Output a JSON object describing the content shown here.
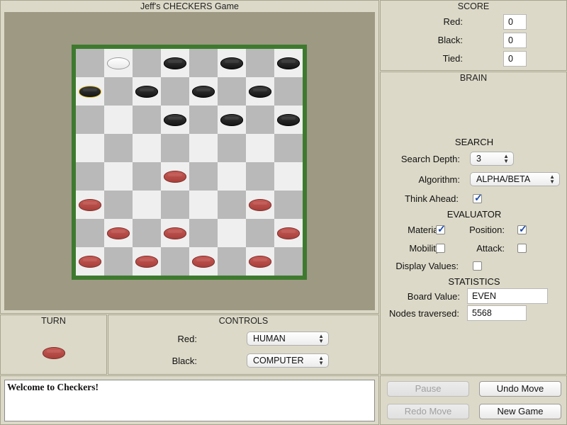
{
  "game": {
    "title": "Jeff's CHECKERS Game"
  },
  "board": {
    "light_color": "#efefef",
    "dark_color": "#b9b9b9",
    "frame_color": "#3e7a2e",
    "pieces": [
      {
        "row": 0,
        "col": 1,
        "color": "white"
      },
      {
        "row": 0,
        "col": 3,
        "color": "black"
      },
      {
        "row": 0,
        "col": 5,
        "color": "black"
      },
      {
        "row": 0,
        "col": 7,
        "color": "black"
      },
      {
        "row": 1,
        "col": 0,
        "color": "black",
        "selected": true
      },
      {
        "row": 1,
        "col": 2,
        "color": "black"
      },
      {
        "row": 1,
        "col": 4,
        "color": "black"
      },
      {
        "row": 1,
        "col": 6,
        "color": "black"
      },
      {
        "row": 2,
        "col": 3,
        "color": "black"
      },
      {
        "row": 2,
        "col": 5,
        "color": "black"
      },
      {
        "row": 2,
        "col": 7,
        "color": "black"
      },
      {
        "row": 4,
        "col": 3,
        "color": "red"
      },
      {
        "row": 5,
        "col": 0,
        "color": "red"
      },
      {
        "row": 5,
        "col": 6,
        "color": "red"
      },
      {
        "row": 6,
        "col": 1,
        "color": "red"
      },
      {
        "row": 6,
        "col": 3,
        "color": "red"
      },
      {
        "row": 6,
        "col": 7,
        "color": "red"
      },
      {
        "row": 7,
        "col": 0,
        "color": "red"
      },
      {
        "row": 7,
        "col": 2,
        "color": "red"
      },
      {
        "row": 7,
        "col": 4,
        "color": "red"
      },
      {
        "row": 7,
        "col": 6,
        "color": "red"
      }
    ]
  },
  "score": {
    "title": "SCORE",
    "red_label": "Red:",
    "red_value": "0",
    "black_label": "Black:",
    "black_value": "0",
    "tied_label": "Tied:",
    "tied_value": "0"
  },
  "brain": {
    "title": "BRAIN",
    "search_title": "SEARCH",
    "depth_label": "Search Depth:",
    "depth_value": "3",
    "algorithm_label": "Algorithm:",
    "algorithm_value": "ALPHA/BETA",
    "think_label": "Think Ahead:",
    "think_checked": true,
    "evaluator_title": "EVALUATOR",
    "material_label": "Material:",
    "material_checked": true,
    "position_label": "Position:",
    "position_checked": true,
    "mobility_label": "Mobility:",
    "mobility_checked": false,
    "attack_label": "Attack:",
    "attack_checked": false,
    "display_label": "Display Values:",
    "display_checked": false,
    "statistics_title": "STATISTICS",
    "board_value_label": "Board Value:",
    "board_value": "EVEN",
    "nodes_label": "Nodes traversed:",
    "nodes_value": "5568"
  },
  "turn": {
    "title": "TURN",
    "color": "red"
  },
  "controls": {
    "title": "CONTROLS",
    "red_label": "Red:",
    "red_value": "HUMAN",
    "black_label": "Black:",
    "black_value": "COMPUTER"
  },
  "log": {
    "text": "Welcome to Checkers!"
  },
  "buttons": {
    "pause": "Pause",
    "undo": "Undo Move",
    "redo": "Redo Move",
    "new_game": "New Game"
  }
}
